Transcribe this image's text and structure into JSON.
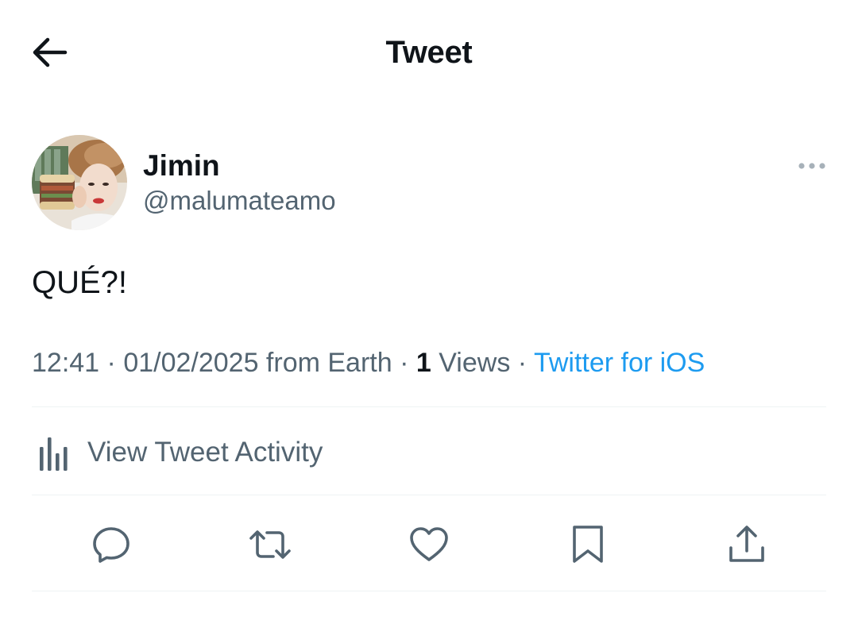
{
  "header": {
    "title": "Tweet",
    "back_icon": "arrow-left-icon"
  },
  "tweet": {
    "author": {
      "name": "Jimin",
      "handle": "@malumateamo",
      "avatar": "profile-photo"
    },
    "text": "QUÉ?!",
    "meta": {
      "time": "12:41",
      "sep1": " · ",
      "date": "01/02/2025",
      "location": " from Earth",
      "sep2": " · ",
      "views_count": "1",
      "views_label": " Views",
      "sep3": " · ",
      "source": "Twitter for iOS"
    },
    "activity_label": "View Tweet Activity"
  },
  "actions": [
    {
      "name": "reply",
      "icon": "reply-icon"
    },
    {
      "name": "retweet",
      "icon": "retweet-icon"
    },
    {
      "name": "like",
      "icon": "heart-icon"
    },
    {
      "name": "bookmark",
      "icon": "bookmark-icon"
    },
    {
      "name": "share",
      "icon": "share-icon"
    }
  ],
  "colors": {
    "text": "#0f1419",
    "secondary": "#536471",
    "link": "#1d9bf0",
    "divider": "#eff3f4"
  }
}
